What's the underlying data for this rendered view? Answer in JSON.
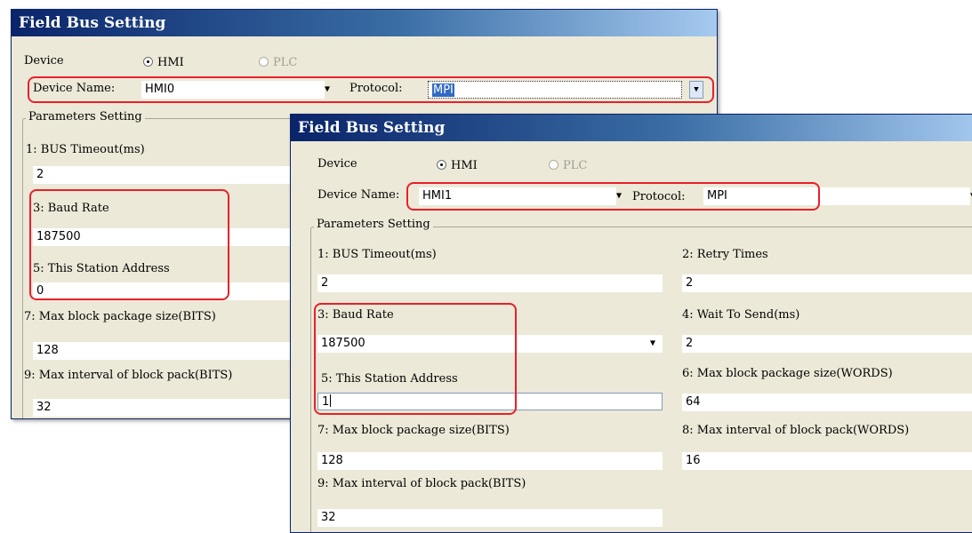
{
  "back_window": {
    "title": "Field Bus Setting",
    "device_label": "Device",
    "radio_hmi": "HMI",
    "radio_plc": "PLC",
    "device_name_label": "Device Name:",
    "device_name_value": "HMI0",
    "protocol_label": "Protocol:",
    "protocol_value": "MPI",
    "params_legend": "Parameters Setting",
    "params": {
      "p1_label": "1: BUS Timeout(ms)",
      "p1_value": "2",
      "p3_label": "3: Baud Rate",
      "p3_value": "187500",
      "p5_label": "5: This Station Address",
      "p5_value": "0",
      "p7_label": "7: Max block package size(BITS)",
      "p7_value": "128",
      "p9_label": "9: Max interval of block pack(BITS)",
      "p9_value": "32"
    }
  },
  "front_window": {
    "title": "Field Bus Setting",
    "device_label": "Device",
    "radio_hmi": "HMI",
    "radio_plc": "PLC",
    "device_name_label": "Device Name:",
    "device_name_value": "HMI1",
    "protocol_label": "Protocol:",
    "protocol_value": "MPI",
    "params_legend": "Parameters Setting",
    "params": {
      "p1_label": "1: BUS Timeout(ms)",
      "p1_value": "2",
      "p2_label": "2: Retry Times",
      "p2_value": "2",
      "p3_label": "3: Baud Rate",
      "p3_value": "187500",
      "p4_label": "4: Wait To Send(ms)",
      "p4_value": "2",
      "p5_label": "5: This Station Address",
      "p5_value": "1",
      "p6_label": "6: Max block package size(WORDS)",
      "p6_value": "64",
      "p7_label": "7: Max block package size(BITS)",
      "p7_value": "128",
      "p8_label": "8: Max interval of block pack(WORDS)",
      "p8_value": "16",
      "p9_label": "9: Max interval of block pack(BITS)",
      "p9_value": "32"
    }
  },
  "colors": {
    "highlight": "#e8202a",
    "title_bar": "#0a246a",
    "dialog_bg": "#ece9d8"
  }
}
